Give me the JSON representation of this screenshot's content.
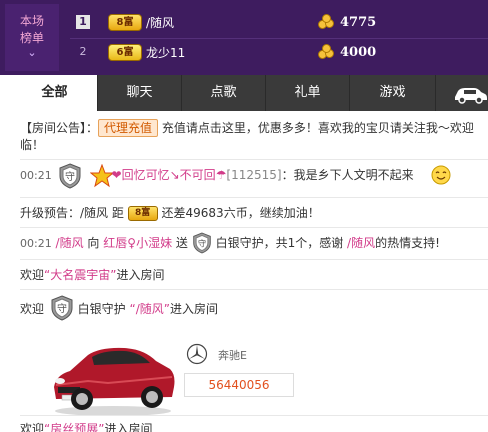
{
  "rank": {
    "label_line1": "本场",
    "label_line2": "榜单",
    "rows": [
      {
        "num": "1",
        "badge": "8富",
        "name": "/随风",
        "score": "4775"
      },
      {
        "num": "2",
        "badge": "6富",
        "name": "龙少11",
        "score": "4000"
      }
    ]
  },
  "tabs": [
    "全部",
    "聊天",
    "点歌",
    "礼单",
    "游戏"
  ],
  "messages": {
    "announce_prefix": "【房间公告】：",
    "announce_btn": "代理充值",
    "announce_text1": "充值请点击这里，优惠多多！喜欢我的宝贝请关注我～欢迎",
    "announce_text2": "临！",
    "chat1_time": "00:21",
    "chat1_user": "❤回忆可忆↘不可回☂",
    "chat1_id": "[112515]",
    "chat1_text": "：我是乡下人文明不起来",
    "upgrade_prefix": "升级预告：/随风 距",
    "upgrade_badge": "8富",
    "upgrade_text": "还差49683六币，继续加油！",
    "gift_time": "00:21",
    "gift_user": "/随风",
    "gift_to": "向",
    "gift_target": "红唇",
    "gift_target2": "小湿妹",
    "gift_send": "送",
    "gift_item": "白银守护，共1个，感谢",
    "gift_thanks_user": "/随风",
    "gift_thanks": "的热情支持!",
    "welcome1_prefix": "欢迎",
    "welcome1_user": "“大名震宇宙”",
    "welcome1_suffix": "进入房间",
    "welcome2_prefix": "欢迎",
    "welcome2_mid": "白银守护",
    "welcome2_user": "“/随风”",
    "welcome2_suffix": "进入房间",
    "car_name": "奔驰E",
    "car_id": "56440056",
    "welcome3_prefix": "欢迎",
    "welcome3_user": "“房丝预展”",
    "welcome3_suffix": "进入房间"
  },
  "colors": {
    "rank_bg": "#3e1c5f",
    "tab_bg": "#3a3a3a",
    "accent_pink": "#d23c8a",
    "accent_red": "#cc2a2a"
  }
}
